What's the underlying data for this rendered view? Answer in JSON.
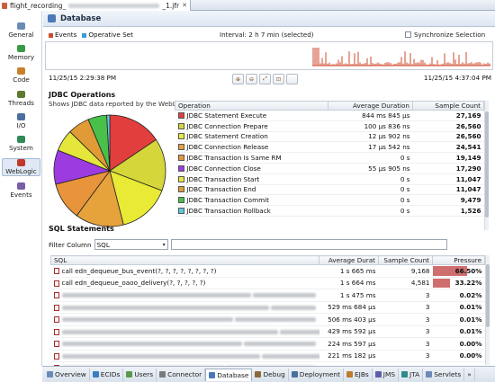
{
  "editor_tab": {
    "file_prefix": "flight_recording_",
    "file_suffix": "_1.jfr",
    "close": "✕"
  },
  "rail": [
    {
      "label": "General",
      "icon": "general-icon",
      "color": "#6a8bb5"
    },
    {
      "label": "Memory",
      "icon": "memory-icon",
      "color": "#3b9a48"
    },
    {
      "label": "Code",
      "icon": "code-icon",
      "color": "#c7812b"
    },
    {
      "label": "Threads",
      "icon": "threads-icon",
      "color": "#5d7a2e"
    },
    {
      "label": "I/O",
      "icon": "io-icon",
      "color": "#4a6f9c"
    },
    {
      "label": "System",
      "icon": "system-icon",
      "color": "#2e8b57"
    },
    {
      "label": "WebLogic",
      "icon": "weblogic-icon",
      "color": "#c0392b",
      "active": true
    },
    {
      "label": "Events",
      "icon": "events-icon",
      "color": "#7a5ea8"
    }
  ],
  "header": {
    "title": "Database"
  },
  "events_bar": {
    "events_label": "Events",
    "operative_label": "Operative Set",
    "events_color": "#cf4a2e",
    "operative_color": "#3a9bd8",
    "interval": "Interval: 2 h 7 min (selected)",
    "sync_label": "Synchronize Selection"
  },
  "timeline": {
    "start": "11/25/15 2:29:38 PM",
    "end": "11/25/15 4:37:04 PM"
  },
  "toolbar_icons": [
    "zoom-in-icon",
    "zoom-out-icon",
    "zoom-fit-icon",
    "zoom-selection-icon",
    "blank-icon"
  ],
  "jdbc": {
    "title": "JDBC Operations",
    "subtitle": "Shows JDBC data reported by the WebLogic Diagnostics Framework (WLDF).",
    "columns": [
      "Operation",
      "Average Duration",
      "Sample Count"
    ],
    "rows": [
      {
        "op": "JDBC Statement Execute",
        "avg": "844 ms 845 µs",
        "count": "27,169",
        "color": "#e23e3e"
      },
      {
        "op": "JDBC Connection Prepare",
        "avg": "100 µs 836 ns",
        "count": "26,560",
        "color": "#d4d63a"
      },
      {
        "op": "JDBC Statement Creation",
        "avg": "12 µs 902 ns",
        "count": "26,560",
        "color": "#e8ea36"
      },
      {
        "op": "JDBC Connection Release",
        "avg": "17 µs 542 ns",
        "count": "24,541",
        "color": "#e6a33c"
      },
      {
        "op": "JDBC Transaction Is Same RM",
        "avg": "0 s",
        "count": "19,149",
        "color": "#e8943a"
      },
      {
        "op": "JDBC Connection Close",
        "avg": "55 µs 905 ns",
        "count": "17,290",
        "color": "#9b3be0"
      },
      {
        "op": "JDBC Transaction Start",
        "avg": "0 s",
        "count": "11,047",
        "color": "#e4e63c"
      },
      {
        "op": "JDBC Transaction End",
        "avg": "0 s",
        "count": "11,047",
        "color": "#e09a36"
      },
      {
        "op": "JDBC Transaction Commit",
        "avg": "0 s",
        "count": "9,479",
        "color": "#48c04a"
      },
      {
        "op": "JDBC Transaction Rollback",
        "avg": "0 s",
        "count": "1,526",
        "color": "#5ec8e0"
      }
    ]
  },
  "chart_data": {
    "type": "pie",
    "categories": [
      "JDBC Statement Execute",
      "JDBC Connection Prepare",
      "JDBC Statement Creation",
      "JDBC Connection Release",
      "JDBC Transaction Is Same RM",
      "JDBC Connection Close",
      "JDBC Transaction Start",
      "JDBC Transaction End",
      "JDBC Transaction Commit",
      "JDBC Transaction Rollback"
    ],
    "values": [
      27169,
      26560,
      26560,
      24541,
      19149,
      17290,
      11047,
      11047,
      9479,
      1526
    ],
    "colors": [
      "#e23e3e",
      "#d4d63a",
      "#e8ea36",
      "#e6a33c",
      "#e8943a",
      "#9b3be0",
      "#e4e63c",
      "#e09a36",
      "#48c04a",
      "#5ec8e0"
    ]
  },
  "sql": {
    "title": "SQL Statements",
    "filter_label": "Filter Column",
    "filter_value": "SQL",
    "filter_arrow": "▾",
    "columns": [
      "SQL",
      "Average Durat",
      "Sample Count",
      "Pressure"
    ],
    "rows": [
      {
        "sql": "call edn_dequeue_bus_event(?, ?, ?, ?, ?, ?, ?, ?)",
        "redacted": false,
        "avg": "1 s 665 ms",
        "count": "9,168",
        "pressure": "66.50%",
        "pressure_value": 66.5
      },
      {
        "sql": "call edn_dequeue_oaoo_delivery(?, ?, ?, ?, ?)",
        "redacted": false,
        "avg": "1 s 664 ms",
        "count": "4,581",
        "pressure": "33.22%",
        "pressure_value": 33.22
      },
      {
        "sql": "",
        "redacted": true,
        "avg": "1 s 475 ms",
        "count": "3",
        "pressure": "0.02%",
        "pressure_value": 0.02
      },
      {
        "sql": "",
        "redacted": true,
        "avg": "529 ms 684 µs",
        "count": "3",
        "pressure": "0.01%",
        "pressure_value": 0.01
      },
      {
        "sql": "",
        "redacted": true,
        "avg": "506 ms 403 µs",
        "count": "3",
        "pressure": "0.01%",
        "pressure_value": 0.01
      },
      {
        "sql": "",
        "redacted": true,
        "avg": "429 ms 592 µs",
        "count": "3",
        "pressure": "0.01%",
        "pressure_value": 0.01
      },
      {
        "sql": "",
        "redacted": true,
        "avg": "224 ms 597 µs",
        "count": "3",
        "pressure": "0.00%",
        "pressure_value": 0.0
      },
      {
        "sql": "",
        "redacted": true,
        "avg": "221 ms 182 µs",
        "count": "3",
        "pressure": "0.00%",
        "pressure_value": 0.0
      },
      {
        "sql": "",
        "redacted": true,
        "avg": "218 ms 279 µs",
        "count": "3",
        "pressure": "0.00%",
        "pressure_value": 0.0
      },
      {
        "sql": "",
        "redacted": true,
        "avg": "1 s 103 ms",
        "count": "3",
        "pressure": "0.00%",
        "pressure_value": 0.0
      }
    ]
  },
  "bottom_tabs": [
    {
      "label": "Overview",
      "icon": "overview-icon",
      "color": "#6a8bb5"
    },
    {
      "label": "ECIDs",
      "icon": "ecids-icon",
      "color": "#3a7fc0"
    },
    {
      "label": "Users",
      "icon": "users-icon",
      "color": "#5a9a4a"
    },
    {
      "label": "Connector",
      "icon": "connector-icon",
      "color": "#7a7a7a"
    },
    {
      "label": "Database",
      "icon": "database-icon",
      "color": "#4a78b8",
      "active": true
    },
    {
      "label": "Debug",
      "icon": "debug-icon",
      "color": "#8a6a3a"
    },
    {
      "label": "Deployment",
      "icon": "deployment-icon",
      "color": "#4a6f9c"
    },
    {
      "label": "EJBs",
      "icon": "ejbs-icon",
      "color": "#c07a2e"
    },
    {
      "label": "JMS",
      "icon": "jms-icon",
      "color": "#5e5ea8"
    },
    {
      "label": "JTA",
      "icon": "jta-icon",
      "color": "#2e8b8b"
    },
    {
      "label": "Servlets",
      "icon": "servlets-icon",
      "color": "#6a8bb5"
    },
    {
      "label": "»",
      "icon": "more-tabs-icon",
      "color": "#555"
    }
  ]
}
